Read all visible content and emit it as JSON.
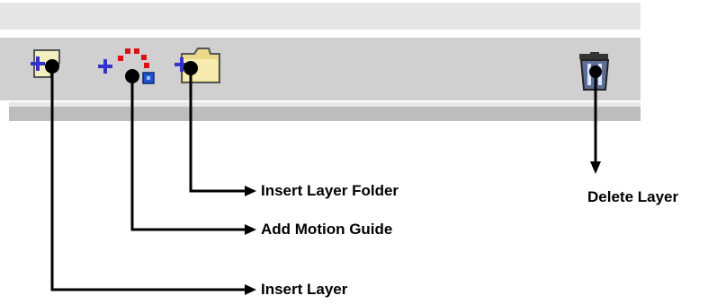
{
  "toolbar": {
    "icons": [
      {
        "name": "insert-layer-icon"
      },
      {
        "name": "add-motion-guide-icon"
      },
      {
        "name": "insert-layer-folder-icon"
      },
      {
        "name": "delete-layer-icon"
      }
    ]
  },
  "callouts": {
    "insert_layer_folder": "Insert Layer Folder",
    "add_motion_guide": "Add Motion Guide",
    "insert_layer": "Insert Layer",
    "delete_layer": "Delete Layer"
  }
}
